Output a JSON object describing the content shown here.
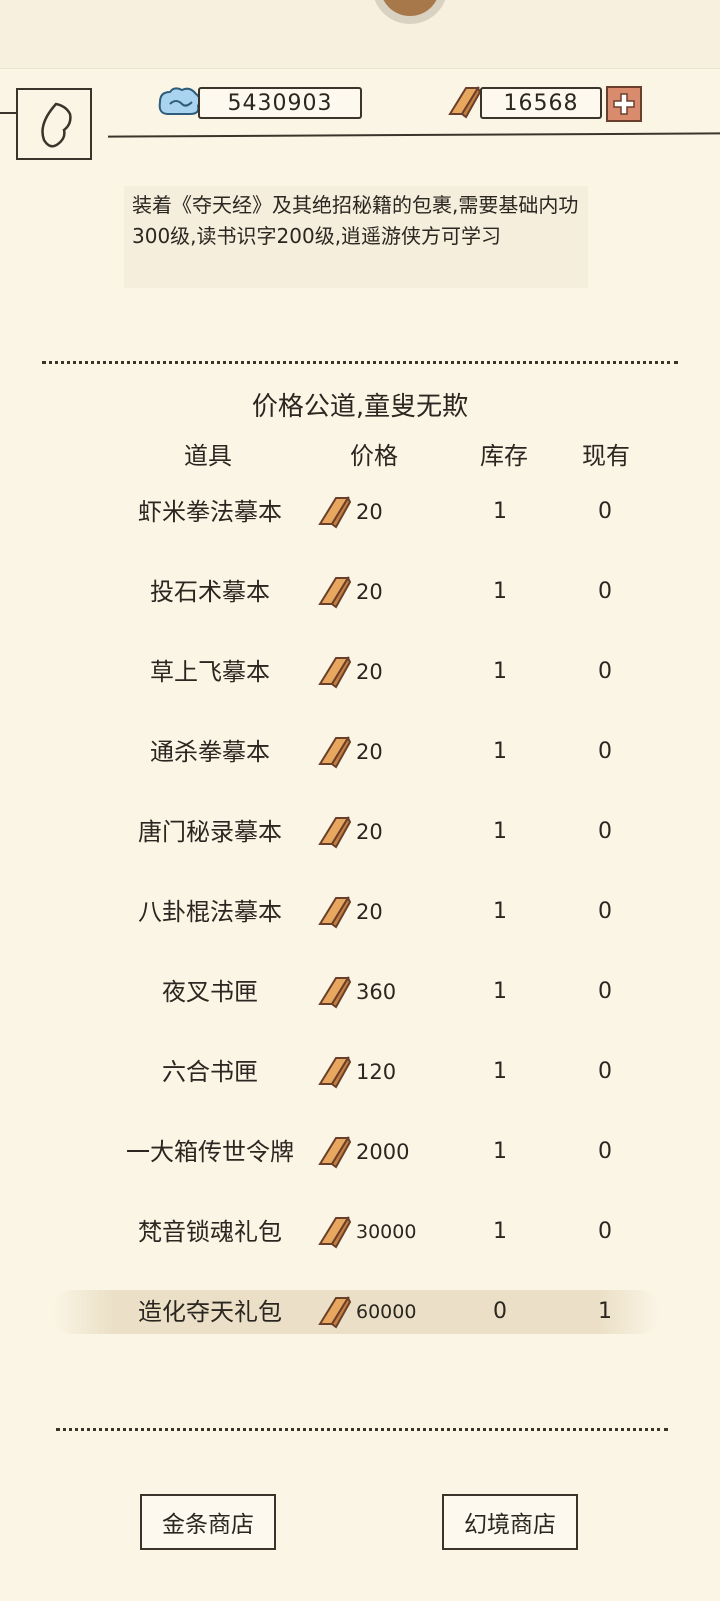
{
  "header": {
    "silver_amount": "5430903",
    "gold_amount": "16568"
  },
  "description": "装着《夺天经》及其绝招秘籍的包裹,需要基础内功300级,读书识字200级,逍遥游侠方可学习",
  "shop": {
    "title": "价格公道,童叟无欺",
    "columns": {
      "item": "道具",
      "price": "价格",
      "stock": "库存",
      "owned": "现有"
    },
    "items": [
      {
        "name": "虾米拳法摹本",
        "price": "20",
        "stock": "1",
        "owned": "0"
      },
      {
        "name": "投石术摹本",
        "price": "20",
        "stock": "1",
        "owned": "0"
      },
      {
        "name": "草上飞摹本",
        "price": "20",
        "stock": "1",
        "owned": "0"
      },
      {
        "name": "通杀拳摹本",
        "price": "20",
        "stock": "1",
        "owned": "0"
      },
      {
        "name": "唐门秘录摹本",
        "price": "20",
        "stock": "1",
        "owned": "0"
      },
      {
        "name": "八卦棍法摹本",
        "price": "20",
        "stock": "1",
        "owned": "0"
      },
      {
        "name": "夜叉书匣",
        "price": "360",
        "stock": "1",
        "owned": "0"
      },
      {
        "name": "六合书匣",
        "price": "120",
        "stock": "1",
        "owned": "0"
      },
      {
        "name": "一大箱传世令牌",
        "price": "2000",
        "stock": "1",
        "owned": "0"
      },
      {
        "name": "梵音锁魂礼包",
        "price": "30000",
        "stock": "1",
        "owned": "0"
      },
      {
        "name": "造化夺天礼包",
        "price": "60000",
        "stock": "0",
        "owned": "1"
      }
    ]
  },
  "footer": {
    "gold_shop_label": "金条商店",
    "illusion_shop_label": "幻境商店"
  },
  "icons": {
    "back": "back-arrow-icon",
    "silver": "silver-cloud-icon",
    "gold": "gold-bar-icon",
    "plus": "plus-icon"
  },
  "colors": {
    "background": "#fbf5e6",
    "plus_button": "#d98b6d",
    "gold_bar": "#e8a75e"
  }
}
